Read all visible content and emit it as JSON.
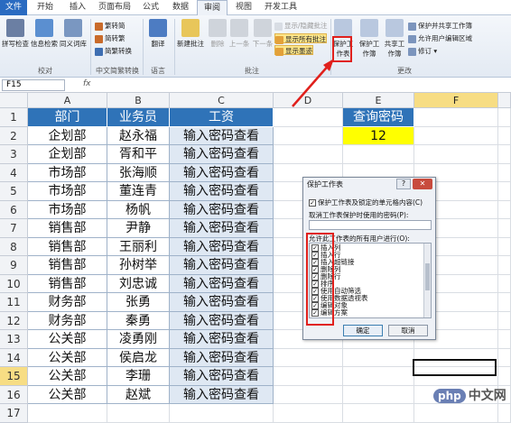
{
  "tabs": [
    "文件",
    "开始",
    "插入",
    "页面布局",
    "公式",
    "数据",
    "审阅",
    "视图",
    "开发工具"
  ],
  "ribbon": {
    "proofing": {
      "spell": "拼写检查",
      "research": "信息检索",
      "thesaurus": "同义词库",
      "label": "校对"
    },
    "chinese": {
      "to_trad": "繁转简",
      "to_simp": "简转繁",
      "convert": "简繁转换",
      "label": "中文简繁转换"
    },
    "language": {
      "translate": "翻译",
      "label": "语言"
    },
    "comments": {
      "new": "新建批注",
      "delete": "删除",
      "prev": "上一条",
      "next": "下一条",
      "show_hide": "显示/隐藏批注",
      "show_all": "显示所有批注",
      "show_ink": "显示墨迹",
      "label": "批注"
    },
    "changes": {
      "protect_sheet": "保护工作表",
      "protect_workbook": "保护工作簿",
      "share_workbook": "共享工作簿",
      "protect_share": "保护并共享工作簿",
      "allow_edit": "允许用户编辑区域",
      "track": "修订",
      "label": "更改"
    }
  },
  "formula_bar": {
    "name_box": "F15",
    "fx": "fx",
    "content": ""
  },
  "columns": [
    "A",
    "B",
    "C",
    "D",
    "E",
    "F"
  ],
  "rows": [
    "1",
    "2",
    "3",
    "4",
    "5",
    "6",
    "7",
    "8",
    "9",
    "10",
    "11",
    "12",
    "13",
    "14",
    "15",
    "16",
    "17"
  ],
  "table": {
    "headers": [
      "部门",
      "业务员",
      "工资"
    ],
    "rows": [
      [
        "企划部",
        "赵永福",
        "输入密码查看"
      ],
      [
        "企划部",
        "胥和平",
        "输入密码查看"
      ],
      [
        "市场部",
        "张海顺",
        "输入密码查看"
      ],
      [
        "市场部",
        "董连青",
        "输入密码查看"
      ],
      [
        "市场部",
        "杨帆",
        "输入密码查看"
      ],
      [
        "销售部",
        "尹静",
        "输入密码查看"
      ],
      [
        "销售部",
        "王丽利",
        "输入密码查看"
      ],
      [
        "销售部",
        "孙树举",
        "输入密码查看"
      ],
      [
        "销售部",
        "刘忠诚",
        "输入密码查看"
      ],
      [
        "财务部",
        "张勇",
        "输入密码查看"
      ],
      [
        "财务部",
        "秦勇",
        "输入密码查看"
      ],
      [
        "公关部",
        "凌勇刚",
        "输入密码查看"
      ],
      [
        "公关部",
        "侯启龙",
        "输入密码查看"
      ],
      [
        "公关部",
        "李珊",
        "输入密码查看"
      ],
      [
        "公关部",
        "赵斌",
        "输入密码查看"
      ]
    ]
  },
  "query": {
    "label": "查询密码",
    "value": "12"
  },
  "dialog": {
    "title": "保护工作表",
    "help": "?",
    "close": "✕",
    "protect_label": "保护工作表及锁定的单元格内容(C)",
    "password_label": "取消工作表保护时使用的密码(P):",
    "allow_label": "允许此工作表的所有用户进行(O):",
    "options": [
      "插入列",
      "插入行",
      "插入超链接",
      "删除列",
      "删除行",
      "排序",
      "使用自动筛选",
      "使用数据透视表",
      "编辑对象",
      "编辑方案"
    ],
    "ok": "确定",
    "cancel": "取消"
  },
  "watermark": {
    "bubble": "php",
    "text": "中文网"
  },
  "colors": {
    "header_blue": "#2f73b8",
    "query_yellow": "#ffff00",
    "highlight_red": "#e0201c",
    "cell_fill": "#dfe8f3"
  }
}
